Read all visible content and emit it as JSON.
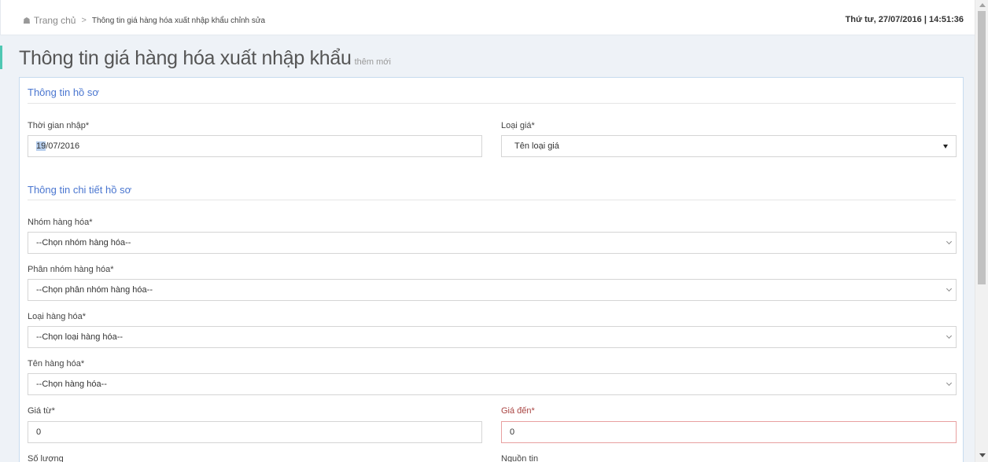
{
  "breadcrumb": {
    "home": "Trang chủ",
    "separator": ">",
    "current": "Thông tin giá hàng hóa xuất nhập khẩu chỉnh sửa"
  },
  "datetime": "Thứ tư, 27/07/2016 | 14:51:36",
  "header": {
    "title": "Thông tin giá hàng hóa xuất nhập khẩu",
    "subtitle": "thêm mới"
  },
  "sections": {
    "profile": "Thông tin hồ sơ",
    "detail": "Thông tin chi tiết hồ sơ"
  },
  "form": {
    "entry_time": {
      "label": "Thời gian nhập*",
      "value_highlight": "19",
      "value_rest": "/07/2016"
    },
    "price_type": {
      "label": "Loại giá*",
      "value": "Tên loại giá"
    },
    "group": {
      "label": "Nhóm hàng hóa*",
      "value": "--Chọn nhóm hàng hóa--"
    },
    "subgroup": {
      "label": "Phân nhóm hàng hóa*",
      "value": "--Chọn phân nhóm hàng hóa--"
    },
    "category": {
      "label": "Loại hàng hóa*",
      "value": "--Chọn loại hàng hóa--"
    },
    "product": {
      "label": "Tên hàng hóa*",
      "value": "--Chọn hàng hóa--"
    },
    "price_from": {
      "label": "Giá từ*",
      "value": "0"
    },
    "price_to": {
      "label": "Giá đến*",
      "value": "0"
    },
    "quantity": {
      "label": "Số lượng"
    },
    "source": {
      "label": "Nguồn tin"
    }
  },
  "colors": {
    "accent": "#4fc7b3",
    "section_title": "#4a76d0",
    "error": "#a94442",
    "page_bg": "#eef2f7"
  }
}
